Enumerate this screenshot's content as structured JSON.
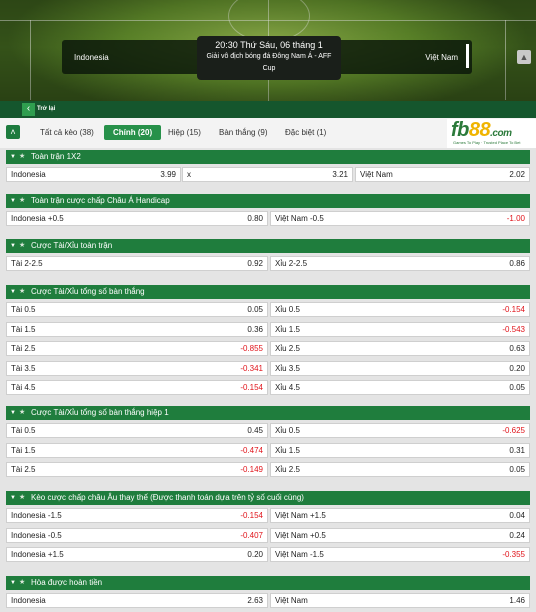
{
  "match": {
    "home": "Indonesia",
    "away": "Việt Nam",
    "time": "20:30 Thứ Sáu, 06 tháng 1",
    "competition_line1": "Giải vô địch bóng đá Đông Nam Á - AFF",
    "competition_line2": "Cup"
  },
  "back_label": "Trở lại",
  "tabs": [
    {
      "label": "Tất cả kèo (38)"
    },
    {
      "label": "Chính (20)"
    },
    {
      "label": "Hiệp (15)"
    },
    {
      "label": "Bàn thắng (9)"
    },
    {
      "label": "Đặc biệt (1)"
    }
  ],
  "logo": {
    "fb": "fb",
    "num": "88",
    "com": ".com",
    "slogan": "Games To Play · Trusted Place To Bet"
  },
  "sections": [
    {
      "title": "Toàn trận 1X2",
      "rows": [
        [
          {
            "label": "Indonesia",
            "value": "3.99"
          },
          {
            "label": "x",
            "value": "3.21"
          },
          {
            "label": "Việt Nam",
            "value": "2.02"
          }
        ]
      ]
    },
    {
      "title": "Toàn trận cược chấp Châu Á Handicap",
      "rows": [
        [
          {
            "label": "Indonesia +0.5",
            "value": "0.80"
          },
          {
            "label": "Việt Nam -0.5",
            "value": "-1.00"
          }
        ]
      ]
    },
    {
      "title": "Cược Tài/Xỉu toàn trận",
      "rows": [
        [
          {
            "label": "Tài 2-2.5",
            "value": "0.92"
          },
          {
            "label": "Xỉu 2-2.5",
            "value": "0.86"
          }
        ]
      ]
    },
    {
      "title": "Cược Tài/Xỉu tổng số bàn thắng",
      "rows": [
        [
          {
            "label": "Tài 0.5",
            "value": "0.05"
          },
          {
            "label": "Xỉu 0.5",
            "value": "-0.154"
          }
        ],
        [
          {
            "label": "Tài 1.5",
            "value": "0.36"
          },
          {
            "label": "Xỉu 1.5",
            "value": "-0.543"
          }
        ],
        [
          {
            "label": "Tài 2.5",
            "value": "-0.855"
          },
          {
            "label": "Xỉu 2.5",
            "value": "0.63"
          }
        ],
        [
          {
            "label": "Tài 3.5",
            "value": "-0.341"
          },
          {
            "label": "Xỉu 3.5",
            "value": "0.20"
          }
        ],
        [
          {
            "label": "Tài 4.5",
            "value": "-0.154"
          },
          {
            "label": "Xỉu 4.5",
            "value": "0.05"
          }
        ]
      ]
    },
    {
      "title": "Cược Tài/Xỉu tổng số bàn thắng hiệp 1",
      "rows": [
        [
          {
            "label": "Tài 0.5",
            "value": "0.45"
          },
          {
            "label": "Xỉu 0.5",
            "value": "-0.625"
          }
        ],
        [
          {
            "label": "Tài 1.5",
            "value": "-0.474"
          },
          {
            "label": "Xỉu 1.5",
            "value": "0.31"
          }
        ],
        [
          {
            "label": "Tài 2.5",
            "value": "-0.149"
          },
          {
            "label": "Xỉu 2.5",
            "value": "0.05"
          }
        ]
      ]
    },
    {
      "title": "Kèo cược chấp châu Âu thay thế (Được thanh toán dựa trên tỷ số cuối cùng)",
      "rows": [
        [
          {
            "label": "Indonesia -1.5",
            "value": "-0.154"
          },
          {
            "label": "Việt Nam +1.5",
            "value": "0.04"
          }
        ],
        [
          {
            "label": "Indonesia -0.5",
            "value": "-0.407"
          },
          {
            "label": "Việt Nam +0.5",
            "value": "0.24"
          }
        ],
        [
          {
            "label": "Indonesia +1.5",
            "value": "0.20"
          },
          {
            "label": "Việt Nam -1.5",
            "value": "-0.355"
          }
        ]
      ]
    },
    {
      "title": "Hòa được hoàn tiền",
      "rows": [
        [
          {
            "label": "Indonesia",
            "value": "2.63"
          },
          {
            "label": "Việt Nam",
            "value": "1.46"
          }
        ]
      ]
    }
  ]
}
